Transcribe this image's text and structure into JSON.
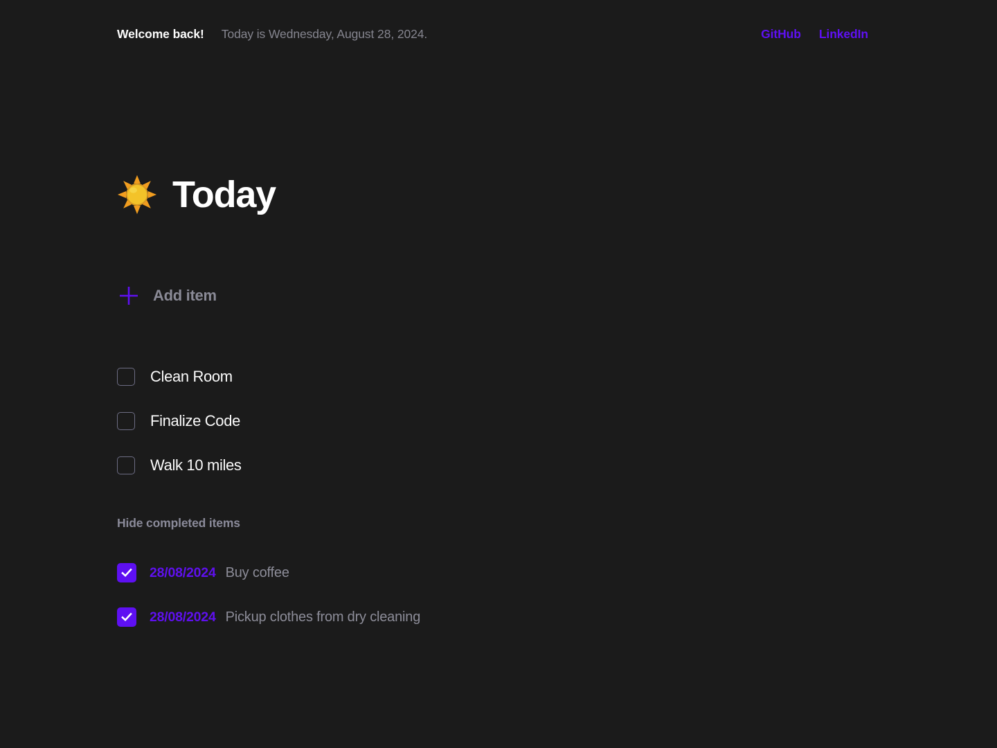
{
  "theme": {
    "background": "#1b1b1b",
    "accent_purple": "#5f10f2",
    "text_primary": "#ffffff",
    "text_muted": "#8a8a99"
  },
  "header": {
    "welcome": "Welcome back!",
    "date_line": "Today is Wednesday, August 28, 2024.",
    "links": [
      {
        "label": "GitHub",
        "name": "github"
      },
      {
        "label": "LinkedIn",
        "name": "linkedin"
      }
    ]
  },
  "main": {
    "heading": "Today",
    "heading_icon": "sun-icon",
    "add_item_label": "Add item",
    "add_item_icon": "plus-icon",
    "tasks": [
      {
        "label": "Clean Room",
        "checked": false
      },
      {
        "label": "Finalize Code",
        "checked": false
      },
      {
        "label": "Walk 10 miles",
        "checked": false
      }
    ],
    "hide_completed_label": "Hide completed items",
    "completed": [
      {
        "date": "28/08/2024",
        "label": "Buy coffee",
        "checked": true
      },
      {
        "date": "28/08/2024",
        "label": "Pickup clothes from dry cleaning",
        "checked": true
      }
    ]
  }
}
